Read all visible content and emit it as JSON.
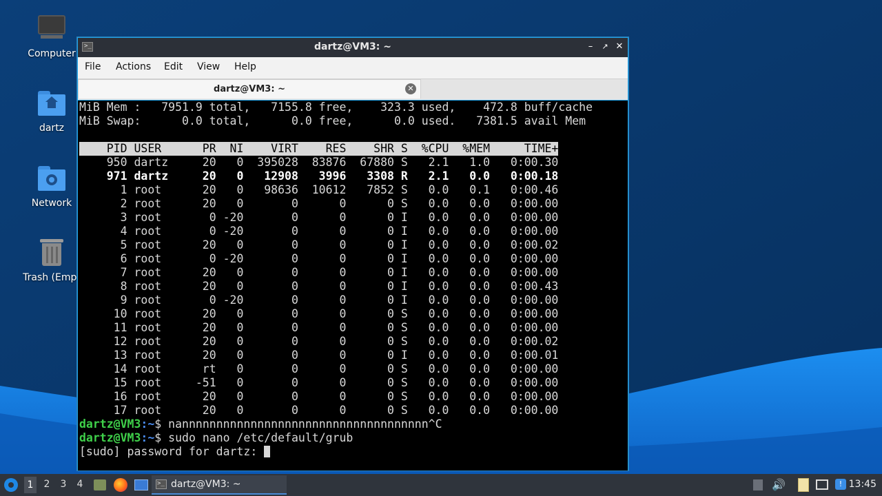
{
  "desktop": {
    "icons": [
      {
        "label": "Computer",
        "icon": "computer-icon"
      },
      {
        "label": "dartz",
        "icon": "home-folder-icon"
      },
      {
        "label": "Network",
        "icon": "network-folder-icon"
      },
      {
        "label": "Trash (Empt",
        "icon": "trash-icon"
      }
    ]
  },
  "window": {
    "title": "dartz@VM3: ~",
    "menu": [
      "File",
      "Actions",
      "Edit",
      "View",
      "Help"
    ],
    "tab_label": "dartz@VM3: ~"
  },
  "terminal": {
    "mem_line": "MiB Mem :   7951.9 total,   7155.8 free,    323.3 used,    472.8 buff/cache",
    "swap_line": "MiB Swap:      0.0 total,      0.0 free,      0.0 used.   7381.5 avail Mem",
    "header": "    PID USER      PR  NI    VIRT    RES    SHR S  %CPU  %MEM     TIME+",
    "rows": [
      "    950 dartz     20   0  395028  83876  67880 S   2.1   1.0   0:00.30",
      "    971 dartz     20   0   12908   3996   3308 R   2.1   0.0   0:00.18",
      "      1 root      20   0   98636  10612   7852 S   0.0   0.1   0:00.46",
      "      2 root      20   0       0      0      0 S   0.0   0.0   0:00.00",
      "      3 root       0 -20       0      0      0 I   0.0   0.0   0:00.00",
      "      4 root       0 -20       0      0      0 I   0.0   0.0   0:00.00",
      "      5 root      20   0       0      0      0 I   0.0   0.0   0:00.02",
      "      6 root       0 -20       0      0      0 I   0.0   0.0   0:00.00",
      "      7 root      20   0       0      0      0 I   0.0   0.0   0:00.00",
      "      8 root      20   0       0      0      0 I   0.0   0.0   0:00.43",
      "      9 root       0 -20       0      0      0 I   0.0   0.0   0:00.00",
      "     10 root      20   0       0      0      0 S   0.0   0.0   0:00.00",
      "     11 root      20   0       0      0      0 S   0.0   0.0   0:00.00",
      "     12 root      20   0       0      0      0 S   0.0   0.0   0:00.02",
      "     13 root      20   0       0      0      0 I   0.0   0.0   0:00.01",
      "     14 root      rt   0       0      0      0 S   0.0   0.0   0:00.00",
      "     15 root     -51   0       0      0      0 S   0.0   0.0   0:00.00",
      "     16 root      20   0       0      0      0 S   0.0   0.0   0:00.00",
      "     17 root      20   0       0      0      0 S   0.0   0.0   0:00.00"
    ],
    "prompt_user": "dartz@VM3",
    "prompt_path": ":~",
    "prompt_symbol": "$",
    "cmd1": " nannnnnnnnnnnnnnnnnnnnnnnnnnnnnnnnnnnn^C",
    "cmd2": " sudo nano /etc/default/grub",
    "sudo_prompt": "[sudo] password for dartz: "
  },
  "taskbar": {
    "workspaces": [
      "1",
      "2",
      "3",
      "4"
    ],
    "task_label": "dartz@VM3: ~",
    "clock": "13:45"
  }
}
